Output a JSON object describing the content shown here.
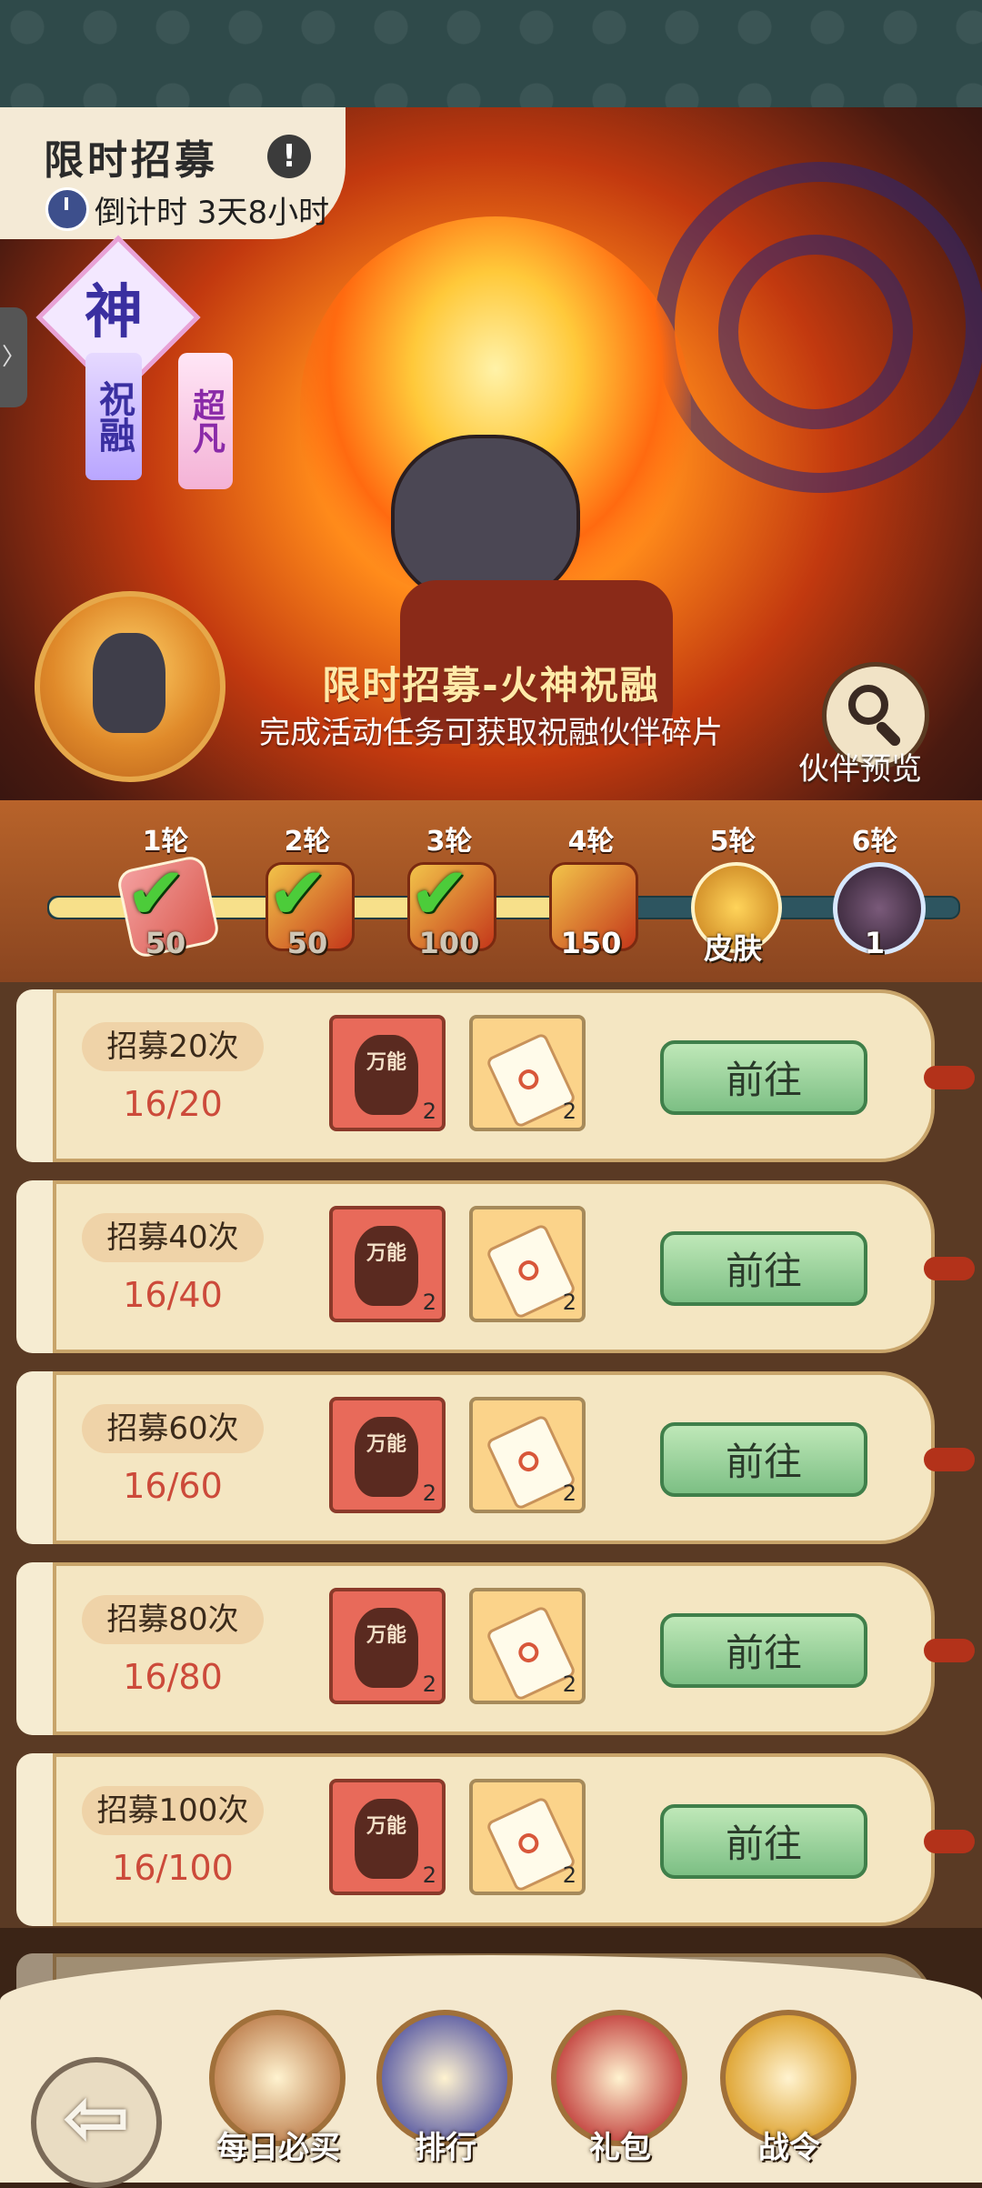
{
  "header": {
    "title": "限时招募",
    "info_icon_glyph": "!",
    "countdown": "倒计时 3天8小时"
  },
  "side_tab": {
    "glyph": "〉"
  },
  "badges": {
    "tier": "神",
    "name": "祝融",
    "rank": "超凡"
  },
  "event": {
    "title": "限时招募-火神祝融",
    "subtitle": "完成活动任务可获取祝融伙伴碎片",
    "preview_label": "伙伴预览"
  },
  "progress": {
    "current": 16,
    "fill_fraction": 0.57,
    "rounds": [
      {
        "label": "1轮",
        "count": "50",
        "completed": true,
        "reward": "card"
      },
      {
        "label": "2轮",
        "count": "50",
        "completed": true,
        "reward": "chest"
      },
      {
        "label": "3轮",
        "count": "100",
        "completed": true,
        "reward": "chest"
      },
      {
        "label": "4轮",
        "count": "150",
        "completed": false,
        "reward": "chest"
      },
      {
        "label": "5轮",
        "count": "皮肤",
        "completed": false,
        "reward": "skin"
      },
      {
        "label": "6轮",
        "count": "1",
        "completed": false,
        "reward": "shard"
      }
    ]
  },
  "tasks": [
    {
      "name": "招募20次",
      "progress": "16/20",
      "item1_label": "万能",
      "item1_count": "2",
      "item2_count": "2",
      "button": "前往"
    },
    {
      "name": "招募40次",
      "progress": "16/40",
      "item1_label": "万能",
      "item1_count": "2",
      "item2_count": "2",
      "button": "前往"
    },
    {
      "name": "招募60次",
      "progress": "16/60",
      "item1_label": "万能",
      "item1_count": "2",
      "item2_count": "2",
      "button": "前往"
    },
    {
      "name": "招募80次",
      "progress": "16/80",
      "item1_label": "万能",
      "item1_count": "2",
      "item2_count": "2",
      "button": "前往"
    },
    {
      "name": "招募100次",
      "progress": "16/100",
      "item1_label": "万能",
      "item1_count": "2",
      "item2_count": "2",
      "button": "前往"
    }
  ],
  "bottom_nav": {
    "back_glyph": "⇦",
    "items": [
      {
        "label": "每日必买",
        "icon": "monkey-666-icon",
        "color": "#c48a5a"
      },
      {
        "label": "排行",
        "icon": "gate-icon",
        "color": "#6a6aa8"
      },
      {
        "label": "礼包",
        "icon": "gift-bag-icon",
        "color": "#c8504a"
      },
      {
        "label": "战令",
        "icon": "warrior-token-icon",
        "color": "#e0a83a"
      }
    ]
  },
  "colors": {
    "progress_fill": "#f7e08a",
    "task_progress": "#cc4a3a",
    "go_button": "#7cbf84"
  }
}
